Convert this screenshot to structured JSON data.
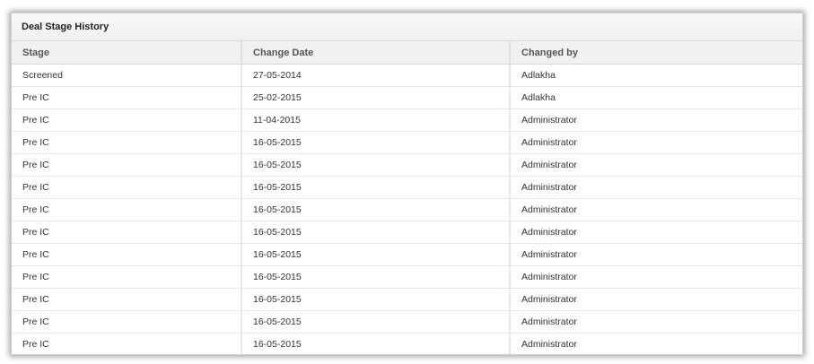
{
  "panel": {
    "title": "Deal Stage History"
  },
  "table": {
    "headers": [
      "Stage",
      "Change Date",
      "Changed by"
    ],
    "rows": [
      [
        "Screened",
        "27-05-2014",
        "Adlakha"
      ],
      [
        "Pre IC",
        "25-02-2015",
        "Adlakha"
      ],
      [
        "Pre IC",
        "11-04-2015",
        "Administrator"
      ],
      [
        "Pre IC",
        "16-05-2015",
        "Administrator"
      ],
      [
        "Pre IC",
        "16-05-2015",
        "Administrator"
      ],
      [
        "Pre IC",
        "16-05-2015",
        "Administrator"
      ],
      [
        "Pre IC",
        "16-05-2015",
        "Administrator"
      ],
      [
        "Pre IC",
        "16-05-2015",
        "Administrator"
      ],
      [
        "Pre IC",
        "16-05-2015",
        "Administrator"
      ],
      [
        "Pre IC",
        "16-05-2015",
        "Administrator"
      ],
      [
        "Pre IC",
        "16-05-2015",
        "Administrator"
      ],
      [
        "Pre IC",
        "16-05-2015",
        "Administrator"
      ],
      [
        "Pre IC",
        "16-05-2015",
        "Administrator"
      ]
    ]
  }
}
